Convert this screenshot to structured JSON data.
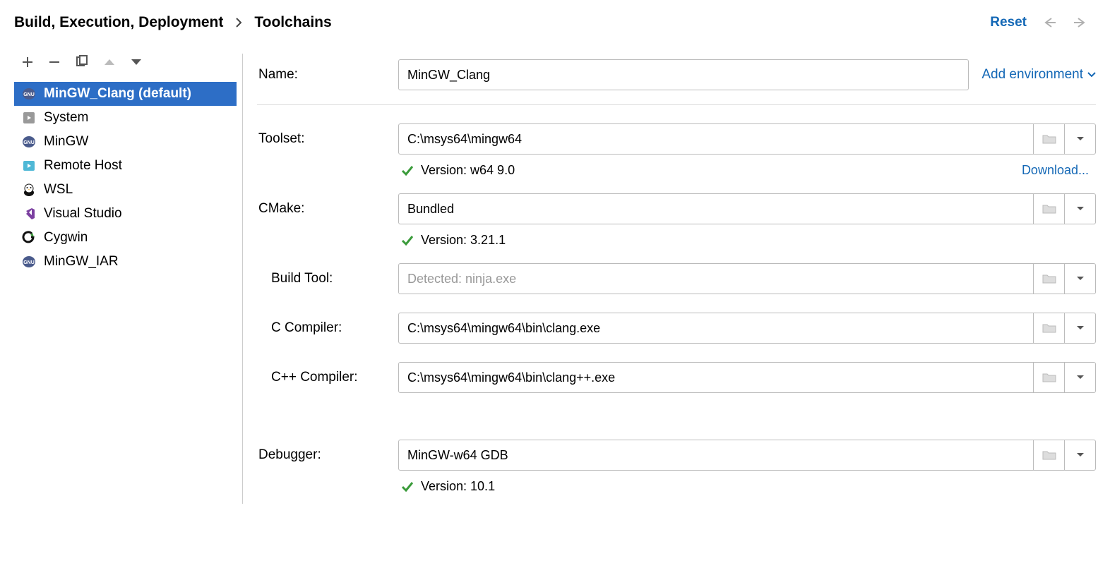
{
  "breadcrumb": {
    "parent": "Build, Execution, Deployment",
    "current": "Toolchains"
  },
  "reset_label": "Reset",
  "add_env_label": "Add environment",
  "sidebar": {
    "items": [
      {
        "label": "MinGW_Clang (default)"
      },
      {
        "label": "System"
      },
      {
        "label": "MinGW"
      },
      {
        "label": "Remote Host"
      },
      {
        "label": "WSL"
      },
      {
        "label": "Visual Studio"
      },
      {
        "label": "Cygwin"
      },
      {
        "label": "MinGW_IAR"
      }
    ]
  },
  "form": {
    "name_label": "Name:",
    "name_value": "MinGW_Clang",
    "toolset_label": "Toolset:",
    "toolset_value": "C:\\msys64\\mingw64",
    "toolset_status": "Version: w64 9.0",
    "download_label": "Download...",
    "cmake_label": "CMake:",
    "cmake_value": "Bundled",
    "cmake_status": "Version: 3.21.1",
    "buildtool_label": "Build Tool:",
    "buildtool_placeholder": "Detected: ninja.exe",
    "ccompiler_label": "C Compiler:",
    "ccompiler_value": "C:\\msys64\\mingw64\\bin\\clang.exe",
    "cxxcompiler_label": "C++ Compiler:",
    "cxxcompiler_value": "C:\\msys64\\mingw64\\bin\\clang++.exe",
    "debugger_label": "Debugger:",
    "debugger_value": "MinGW-w64 GDB",
    "debugger_status": "Version: 10.1"
  }
}
